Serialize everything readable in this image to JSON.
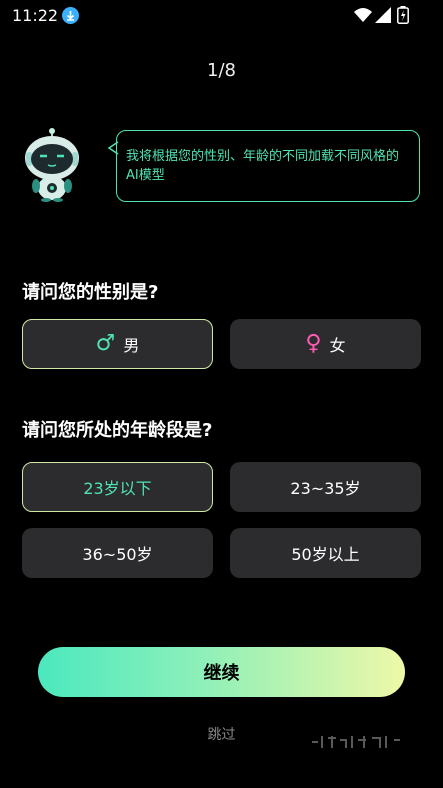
{
  "status_bar": {
    "time": "11:22",
    "icons": [
      "download-icon",
      "wifi-icon",
      "signal-icon",
      "battery-icon"
    ]
  },
  "step_indicator": "1/8",
  "assistant": {
    "message": "我将根据您的性别、年龄的不同加载不同风格的AI模型",
    "accent_color": "#4fe3b4"
  },
  "gender_question": {
    "title": "请问您的性别是?",
    "options": [
      {
        "symbol": "♂",
        "label": "男",
        "selected": true
      },
      {
        "symbol": "♀",
        "label": "女",
        "selected": false
      }
    ]
  },
  "age_question": {
    "title": "请问您所处的年龄段是?",
    "options": [
      {
        "label": "23岁以下",
        "selected": true
      },
      {
        "label": "23~35岁",
        "selected": false
      },
      {
        "label": "36~50岁",
        "selected": false
      },
      {
        "label": "50岁以上",
        "selected": false
      }
    ]
  },
  "actions": {
    "continue_label": "继续",
    "skip_label": "跳过"
  },
  "colors": {
    "background": "#000000",
    "option_bg": "#2c2c2e",
    "accent": "#4fe3b4",
    "female": "#ff5ab4",
    "gradient_start": "#4be8bf",
    "gradient_end": "#eef8a8"
  }
}
